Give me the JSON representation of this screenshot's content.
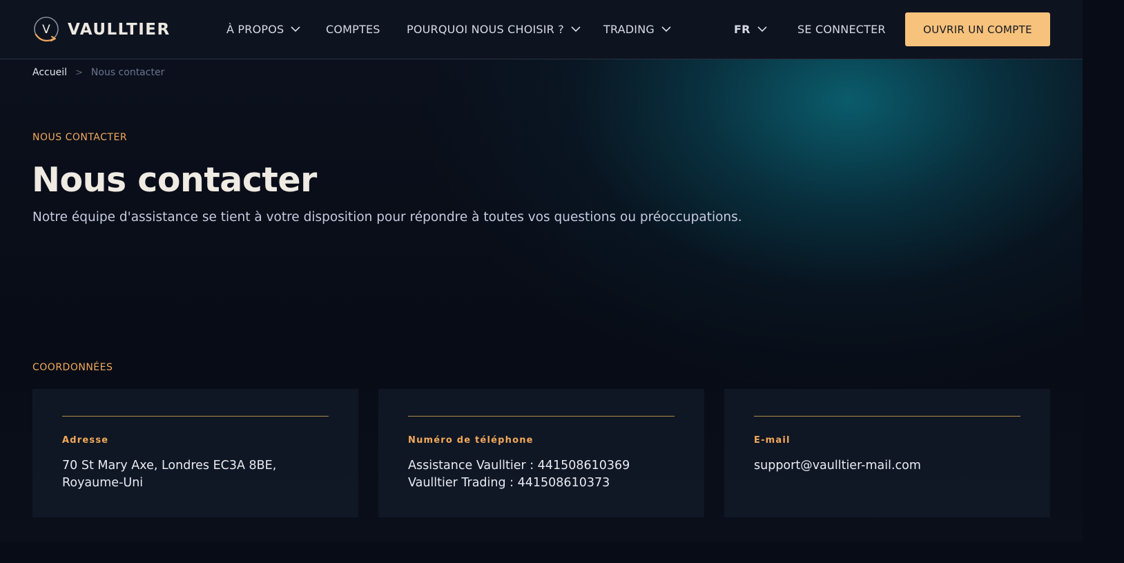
{
  "header": {
    "logo_letter": "V",
    "brand": "VAULLTIER",
    "nav": [
      {
        "label": "À PROPOS",
        "has_dropdown": true
      },
      {
        "label": "COMPTES",
        "has_dropdown": false
      },
      {
        "label": "POURQUOI NOUS CHOISIR ?",
        "has_dropdown": true
      },
      {
        "label": "TRADING",
        "has_dropdown": true
      }
    ],
    "language": "FR",
    "login": "SE CONNECTER",
    "cta": "OUVRIR UN COMPTE"
  },
  "breadcrumb": {
    "home": "Accueil",
    "separator": ">",
    "current": "Nous contacter"
  },
  "hero": {
    "eyebrow": "NOUS CONTACTER",
    "title": "Nous contacter",
    "subtitle": "Notre équipe d'assistance se tient à votre disposition pour répondre à toutes vos questions ou préoccupations."
  },
  "contact": {
    "eyebrow": "COORDONNÉES",
    "cards": [
      {
        "label": "Adresse",
        "lines": [
          "70 St Mary Axe, Londres EC3A 8BE, Royaume-Uni"
        ]
      },
      {
        "label": "Numéro de téléphone",
        "lines": [
          "Assistance Vaulltier : 441508610369",
          "Vaulltier Trading : 441508610373"
        ]
      },
      {
        "label": "E-mail",
        "lines": [
          "support@vaulltier-mail.com"
        ]
      }
    ]
  },
  "colors": {
    "accent": "#f2a95c",
    "cta_bg": "#f7c27c",
    "header_bg": "#0e1320",
    "page_bg": "#080c16",
    "card_bg": "#111826",
    "glow": "#0a6070"
  }
}
